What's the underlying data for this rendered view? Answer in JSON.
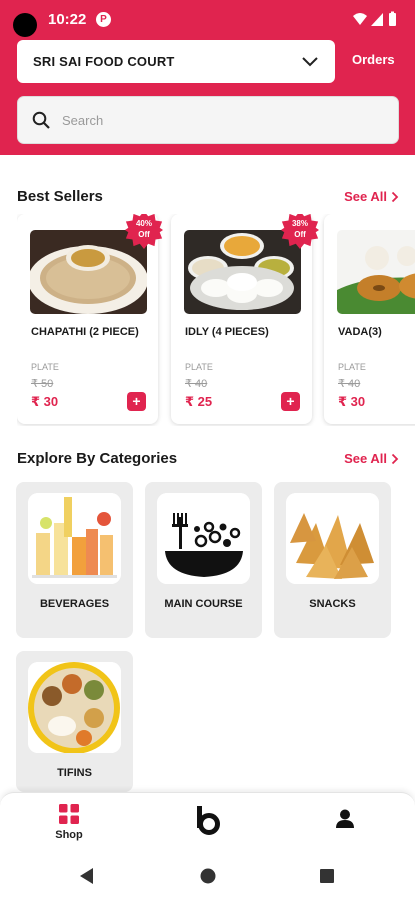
{
  "status_bar": {
    "time": "10:22",
    "notification_badge": "P"
  },
  "header": {
    "store_name": "SRI SAI FOOD COURT",
    "orders_label": "Orders",
    "search_placeholder": "Search"
  },
  "colors": {
    "brand": "#e0244f",
    "card_bg": "#ffffff",
    "category_bg": "#ececec"
  },
  "best_sellers": {
    "title": "Best Sellers",
    "see_all": "See All",
    "items": [
      {
        "name": "CHAPATHI (2 PIECE)",
        "unit": "PLATE",
        "mrp": "₹ 50",
        "price": "₹ 30",
        "offer_percent": "40%",
        "offer_word": "Off"
      },
      {
        "name": "IDLY (4 PIECES)",
        "unit": "PLATE",
        "mrp": "₹ 40",
        "price": "₹ 25",
        "offer_percent": "38%",
        "offer_word": "Off"
      },
      {
        "name": "VADA(3)",
        "unit": "PLATE",
        "mrp": "₹ 40",
        "price": "₹ 30"
      }
    ],
    "add_label": "+"
  },
  "categories": {
    "title": "Explore By Categories",
    "see_all": "See All",
    "items": [
      {
        "label": "BEVERAGES"
      },
      {
        "label": "MAIN COURSE"
      },
      {
        "label": "SNACKS"
      },
      {
        "label": "TIFINS"
      }
    ]
  },
  "bottom_nav": {
    "items": [
      {
        "label": "Shop",
        "icon": "grid-icon",
        "active": true
      },
      {
        "label": "",
        "icon": "brand-b-icon"
      },
      {
        "label": "",
        "icon": "profile-icon"
      }
    ]
  },
  "system_nav": {
    "icons": [
      "back-icon",
      "home-icon",
      "recents-icon"
    ]
  }
}
